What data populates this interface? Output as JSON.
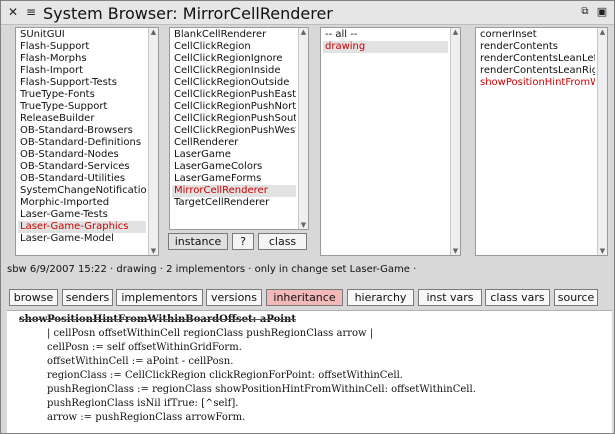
{
  "window": {
    "title": "System Browser: MirrorCellRenderer",
    "icons": [
      "close-icon",
      "menu-icon",
      "collapse-icon",
      "expand-icon"
    ]
  },
  "categories": {
    "items": [
      "SUnitGUI",
      "Flash-Support",
      "Flash-Morphs",
      "Flash-Import",
      "Flash-Support-Tests",
      "TrueType-Fonts",
      "TrueType-Support",
      "ReleaseBuilder",
      "OB-Standard-Browsers",
      "OB-Standard-Definitions",
      "OB-Standard-Nodes",
      "OB-Standard-Services",
      "OB-Standard-Utilities",
      "SystemChangeNotification",
      "Morphic-Imported",
      "Laser-Game-Tests",
      "Laser-Game-Graphics",
      "Laser-Game-Model"
    ],
    "selected_index": 16
  },
  "classes": {
    "items": [
      "BlankCellRenderer",
      "CellClickRegion",
      "CellClickRegionIgnore",
      "CellClickRegionInside",
      "CellClickRegionOutside",
      "CellClickRegionPushEast",
      "CellClickRegionPushNorth",
      "CellClickRegionPushSouth",
      "CellClickRegionPushWest",
      "CellRenderer",
      "LaserGame",
      "LaserGameColors",
      "LaserGameForms",
      "MirrorCellRenderer",
      "TargetCellRenderer"
    ],
    "selected_index": 13
  },
  "protocols": {
    "items": [
      "-- all --",
      "drawing"
    ],
    "selected_index": 1
  },
  "selectors": {
    "items": [
      "cornerInset",
      "renderContents",
      "renderContentsLeanLeft",
      "renderContentsLeanRight",
      "showPositionHintFromWithinCell:"
    ],
    "highlighted_index": 4
  },
  "switches": {
    "instance": "instance",
    "help": "?",
    "class": "class"
  },
  "annotation": "sbw 6/9/2007 15:22 · drawing · 2 implementors · only in change set Laser-Game ·",
  "buttons": [
    "browse",
    "senders",
    "implementors",
    "versions",
    "inheritance",
    "hierarchy",
    "inst vars",
    "class vars",
    "source"
  ],
  "active_button": "inheritance",
  "colors": {
    "selection_text": "#cc0000",
    "active_button_bg": "#f3b8b8",
    "window_bg": "#d8d8d8"
  },
  "code": {
    "header": "showPositionHintFromWithinBoardOffset: aPoint",
    "lines": [
      "| cellPosn offsetWithinCell regionClass pushRegionClass arrow |",
      "cellPosn := self offsetWithinGridForm.",
      "offsetWithinCell := aPoint - cellPosn.",
      "regionClass := CellClickRegion clickRegionForPoint: offsetWithinCell.",
      "pushRegionClass := regionClass showPositionHintFromWithinCell: offsetWithinCell.",
      "pushRegionClass isNil ifTrue: [^self].",
      "arrow := pushRegionClass arrowForm."
    ]
  }
}
